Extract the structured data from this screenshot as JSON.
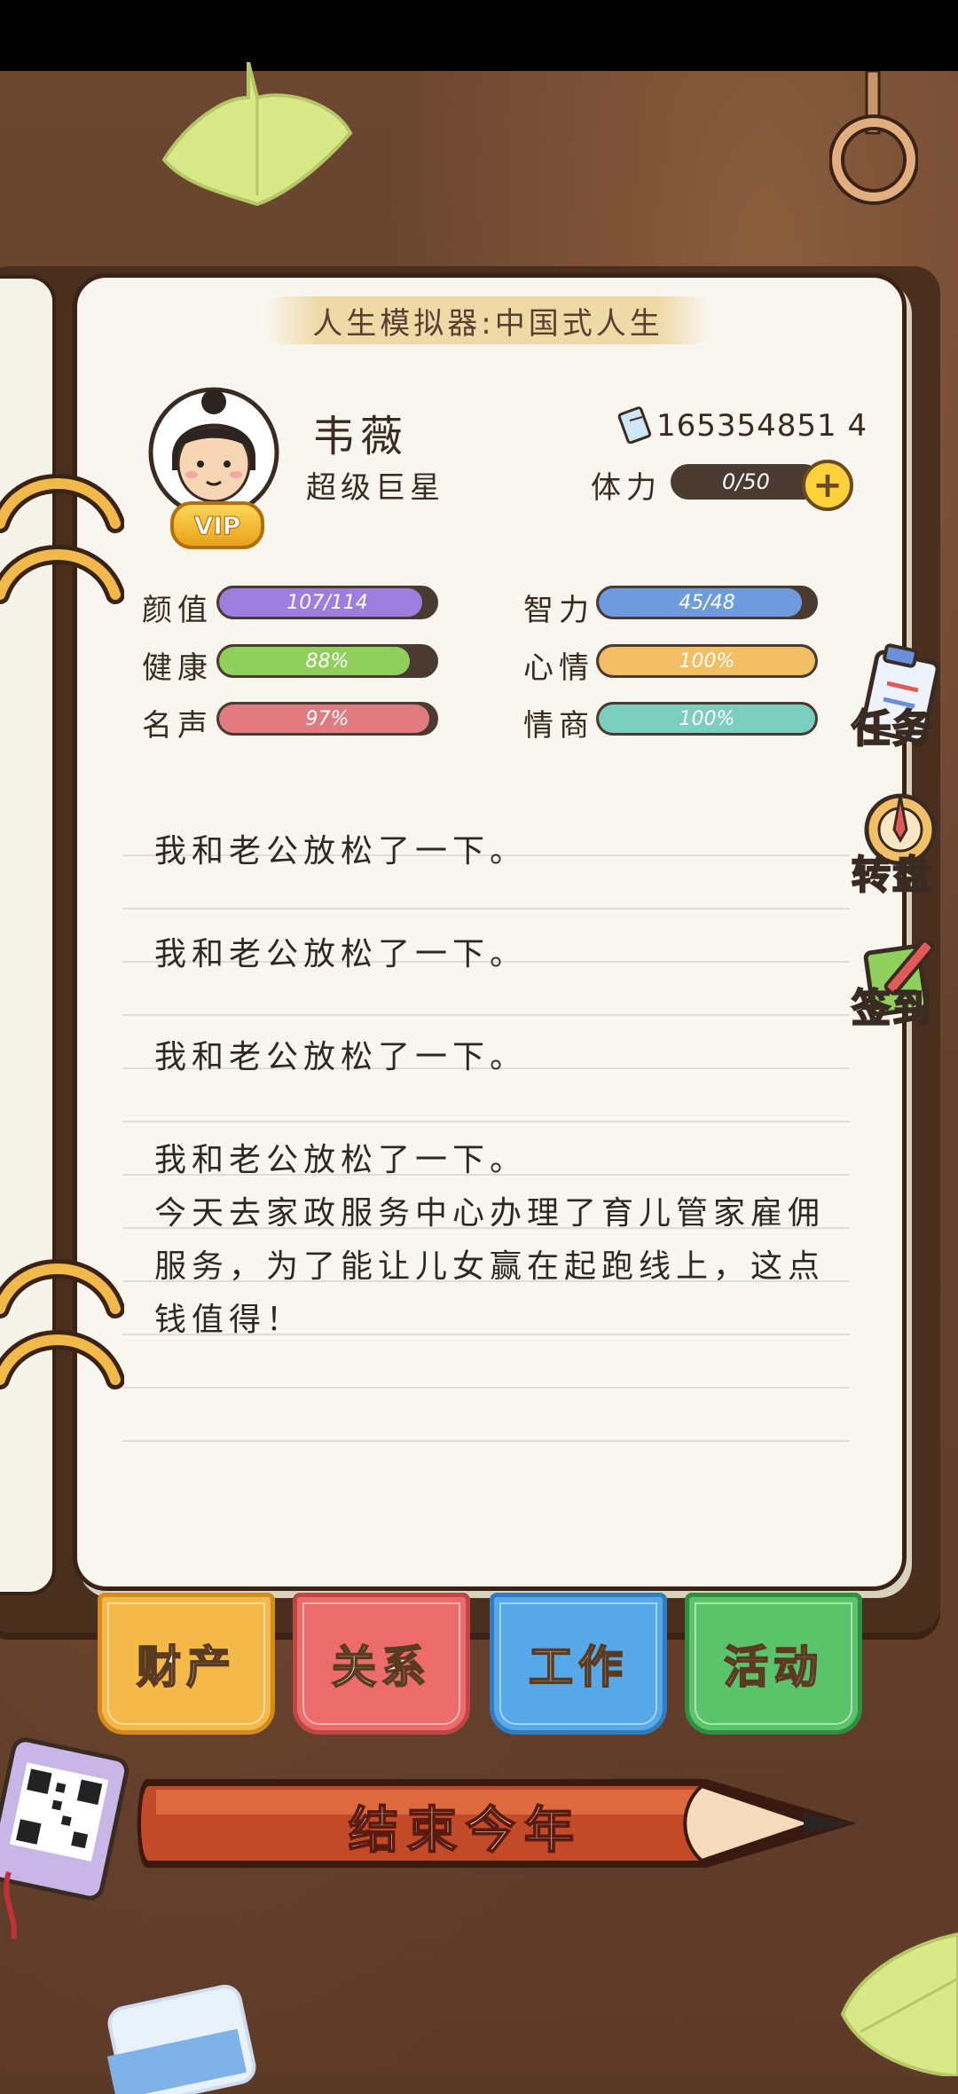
{
  "header": {
    "title": "人生模拟器:中国式人生"
  },
  "profile": {
    "name": "韦薇",
    "rank": "超级巨星",
    "vip_badge": "VIP",
    "money": "165354851 4",
    "stamina_label": "体力",
    "stamina_value": "0/50",
    "stamina_add": "+"
  },
  "stats": [
    {
      "label": "颜值",
      "value": "107/114",
      "fraction": 0.94,
      "color": "#9b7ede"
    },
    {
      "label": "智力",
      "value": "45/48",
      "fraction": 0.94,
      "color": "#6e9ade"
    },
    {
      "label": "健康",
      "value": "88%",
      "fraction": 0.88,
      "color": "#8fd05c"
    },
    {
      "label": "心情",
      "value": "100%",
      "fraction": 1.0,
      "color": "#f2be66"
    },
    {
      "label": "名声",
      "value": "97%",
      "fraction": 0.97,
      "color": "#e27b7f"
    },
    {
      "label": "情商",
      "value": "100%",
      "fraction": 1.0,
      "color": "#7ccfbe"
    }
  ],
  "side_buttons": {
    "task": "任务",
    "wheel": "转盘",
    "checkin": "签到"
  },
  "log": [
    "我和老公放松了一下。",
    "我和老公放松了一下。",
    "我和老公放松了一下。",
    "我和老公放松了一下。\n今天去家政服务中心办理了育儿管家雇佣服务，为了能让儿女赢在起跑线上，这点钱值得！"
  ],
  "tabs": [
    {
      "label": "财产",
      "color": "#f5b94a",
      "edge": "#d48a1c"
    },
    {
      "label": "关系",
      "color": "#ec6b6b",
      "edge": "#c24545"
    },
    {
      "label": "工作",
      "color": "#57a8e8",
      "edge": "#2f7cc0"
    },
    {
      "label": "活动",
      "color": "#5bc36a",
      "edge": "#2f8f3e"
    }
  ],
  "end_year": "结束今年"
}
